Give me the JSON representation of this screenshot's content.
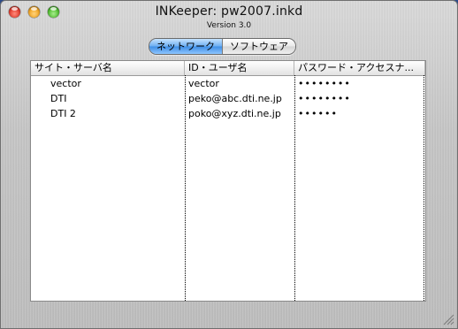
{
  "window": {
    "title": "INKeeper: pw2007.inkd",
    "subtitle": "Version 3.0"
  },
  "tabs": [
    {
      "label": "ネットワーク",
      "selected": true
    },
    {
      "label": "ソフトウェア",
      "selected": false
    }
  ],
  "table": {
    "columns": [
      "サイト・サーバ名",
      "ID・ユーザ名",
      "パスワード・アクセスナ..."
    ],
    "rows": [
      {
        "site": "vector",
        "id": "vector",
        "password": "••••••••"
      },
      {
        "site": "DTI",
        "id": "peko@abc.dti.ne.jp",
        "password": "••••••••"
      },
      {
        "site": "DTI 2",
        "id": "poko@xyz.dti.ne.jp",
        "password": "••••••"
      }
    ]
  },
  "colors": {
    "active_tab": "#4f9bea",
    "window_bg": "#c8c8c8"
  }
}
